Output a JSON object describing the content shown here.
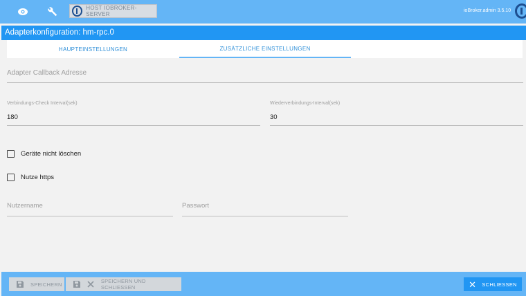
{
  "topbar": {
    "host_button_label": "HOST IOBROKER-SERVER",
    "version": "ioBroker.admin 3.5.10"
  },
  "dialog": {
    "title": "Adapterkonfiguration: hm-rpc.0",
    "tabs": [
      {
        "label": "HAUPTEINSTELLUNGEN",
        "active": false
      },
      {
        "label": "ZUSÄTZLICHE EINSTELLUNGEN",
        "active": true
      }
    ]
  },
  "form": {
    "callback": {
      "placeholder": "Adapter Callback Adresse",
      "value": ""
    },
    "check_interval": {
      "label": "Verbindungs-Check Interval(sek)",
      "value": "180"
    },
    "reconnect_interval": {
      "label": "Wiederverbindungs-Interval(sek)",
      "value": "30"
    },
    "dont_delete_devices": {
      "label": "Geräte nicht löschen",
      "checked": false
    },
    "use_https": {
      "label": "Nutze https",
      "checked": false
    },
    "username": {
      "placeholder": "Nutzername",
      "value": ""
    },
    "password": {
      "placeholder": "Passwort",
      "value": ""
    }
  },
  "footer": {
    "save_label": "SPEICHERN",
    "save_close_label": "SPEICHERN UND SCHLIESSEN",
    "close_label": "SCHLIESSEN"
  },
  "colors": {
    "topbar": "#64b5f6",
    "titlebar": "#2196f3",
    "tab_text": "#2f8fd8"
  }
}
